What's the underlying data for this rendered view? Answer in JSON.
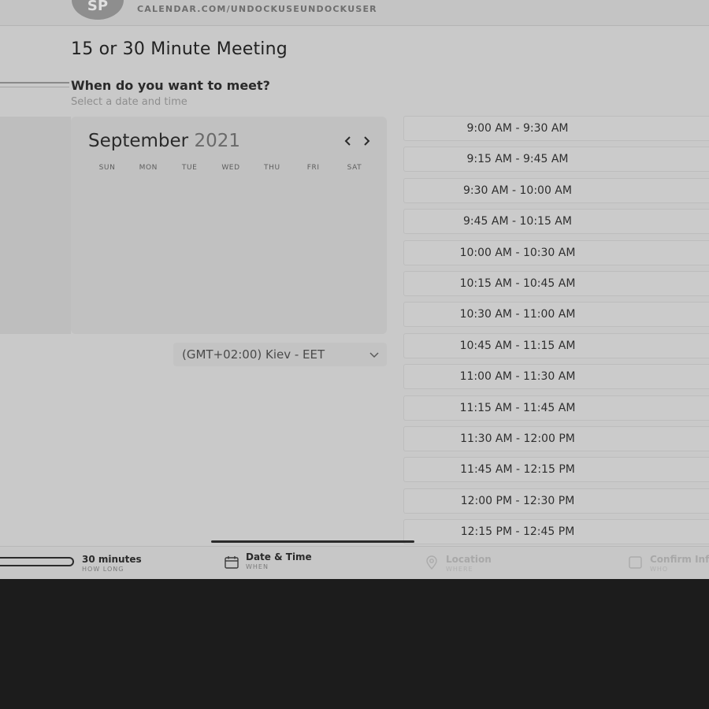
{
  "header": {
    "avatar_initials": "SP",
    "url": "CALENDAR.COM/UNDOCKUSEUNDOCKUSER"
  },
  "meeting": {
    "title": "15 or 30 Minute Meeting",
    "question": "When do you want to meet?",
    "subtitle": "Select a date and time"
  },
  "calendar": {
    "month": "September",
    "year": "2021",
    "prev_icon": "chevron-left",
    "next_icon": "chevron-right",
    "weekdays": [
      "SUN",
      "MON",
      "TUE",
      "WED",
      "THU",
      "FRI",
      "SAT"
    ]
  },
  "timezone": {
    "selected": "(GMT+02:00) Kiev - EET",
    "icon": "chevron-down"
  },
  "slots": [
    "9:00 AM - 9:30 AM",
    "9:15 AM - 9:45 AM",
    "9:30 AM - 10:00 AM",
    "9:45 AM - 10:15 AM",
    "10:00 AM - 10:30 AM",
    "10:15 AM - 10:45 AM",
    "10:30 AM - 11:00 AM",
    "10:45 AM - 11:15 AM",
    "11:00 AM - 11:30 AM",
    "11:15 AM - 11:45 AM",
    "11:30 AM - 12:00 PM",
    "11:45 AM - 12:15 PM",
    "12:00 PM - 12:30 PM",
    "12:15 PM - 12:45 PM"
  ],
  "footer": {
    "steps": [
      {
        "value": "30 minutes",
        "label": "HOW LONG",
        "active": true
      },
      {
        "value": "Date & Time",
        "label": "WHEN",
        "active": true,
        "icon": "calendar-icon"
      },
      {
        "value": "Location",
        "label": "WHERE",
        "active": false,
        "icon": "location-pin-icon"
      },
      {
        "value": "Confirm Info",
        "label": "WHO",
        "active": false,
        "icon": "person-card-icon"
      }
    ]
  }
}
